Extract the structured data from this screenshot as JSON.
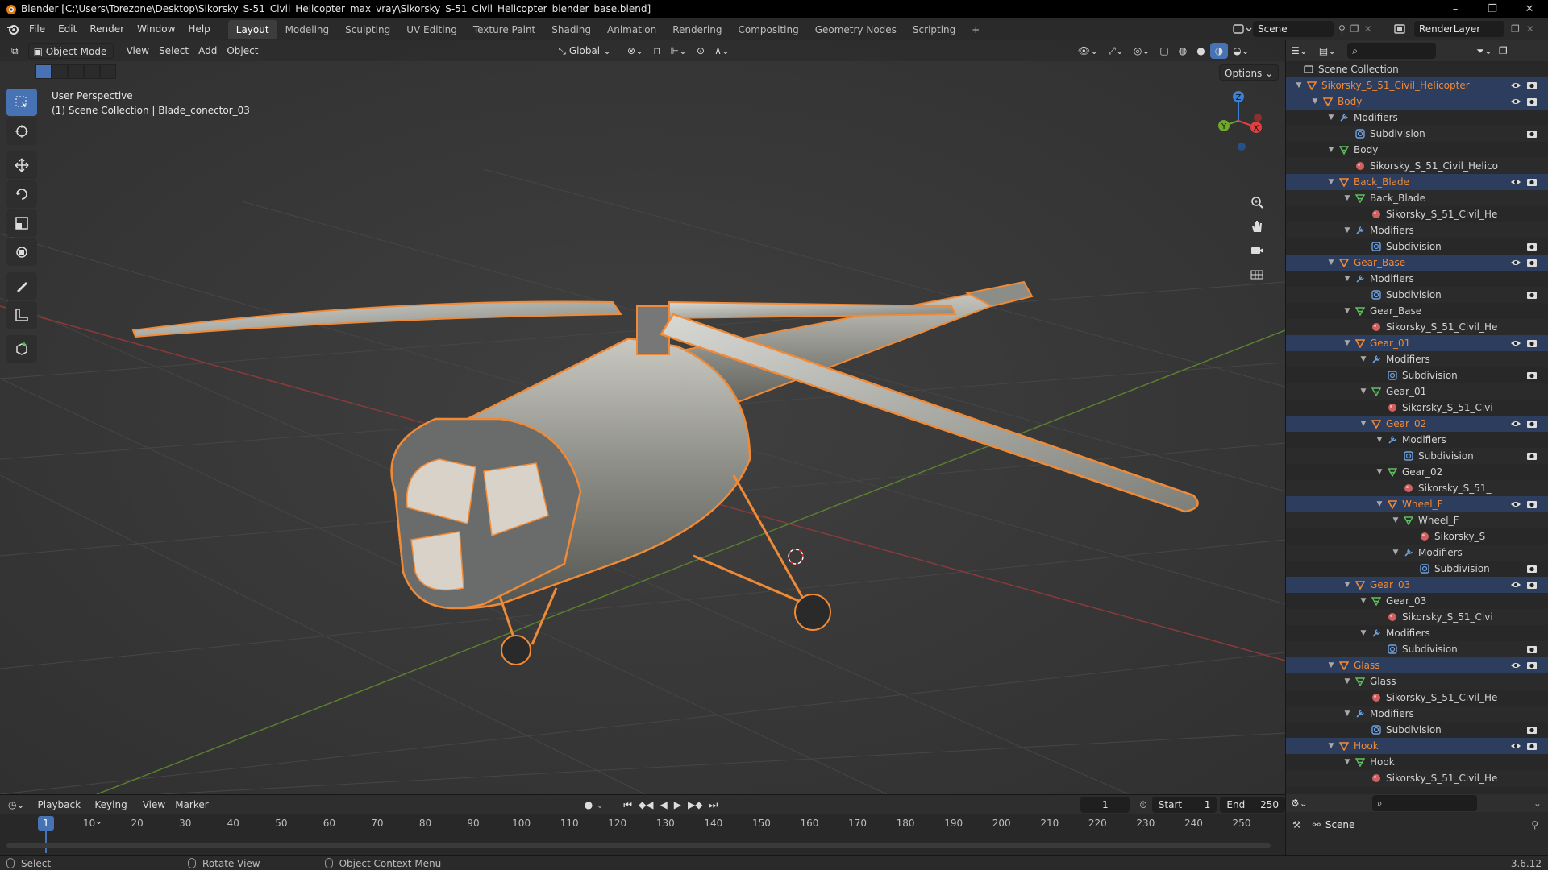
{
  "window": {
    "title": "Blender [C:\\Users\\Torezone\\Desktop\\Sikorsky_S-51_Civil_Helicopter_max_vray\\Sikorsky_S-51_Civil_Helicopter_blender_base.blend]",
    "minimize": "–",
    "maximize": "❐",
    "close": "✕"
  },
  "menu": {
    "items": [
      "File",
      "Edit",
      "Render",
      "Window",
      "Help"
    ],
    "workspaces": [
      "Layout",
      "Modeling",
      "Sculpting",
      "UV Editing",
      "Texture Paint",
      "Shading",
      "Animation",
      "Rendering",
      "Compositing",
      "Geometry Nodes",
      "Scripting"
    ],
    "active_workspace": "Layout",
    "add_tab": "+",
    "scene": "Scene",
    "render_layer": "RenderLayer"
  },
  "viewport": {
    "mode": "Object Mode",
    "menus": [
      "View",
      "Select",
      "Add",
      "Object"
    ],
    "transform_orientation": "Global",
    "options_label": "Options",
    "info_line1": "User Perspective",
    "info_line2": "(1) Scene Collection | Blade_conector_03",
    "gizmo_labels": {
      "z": "Z",
      "y": "Y",
      "x": "X"
    }
  },
  "outliner": {
    "root": "Scene Collection",
    "rows": [
      {
        "label": "Sikorsky_S_51_Civil_Helicopter",
        "depth": 0,
        "type": "object",
        "orange": true,
        "selected": true,
        "vis": true
      },
      {
        "label": "Body",
        "depth": 1,
        "type": "object",
        "orange": true,
        "selected": true,
        "vis": true
      },
      {
        "label": "Modifiers",
        "depth": 2,
        "type": "modifiers",
        "orange": false,
        "selected": false,
        "vis": false
      },
      {
        "label": "Subdivision",
        "depth": 3,
        "type": "subdiv",
        "orange": false,
        "selected": false,
        "vis": "cam"
      },
      {
        "label": "Body",
        "depth": 2,
        "type": "mesh",
        "orange": false,
        "selected": false,
        "vis": false
      },
      {
        "label": "Sikorsky_S_51_Civil_Helico",
        "depth": 3,
        "type": "material",
        "orange": false,
        "selected": false,
        "vis": false
      },
      {
        "label": "Back_Blade",
        "depth": 2,
        "type": "object",
        "orange": true,
        "selected": true,
        "vis": true
      },
      {
        "label": "Back_Blade",
        "depth": 3,
        "type": "mesh",
        "orange": false,
        "selected": false,
        "vis": false
      },
      {
        "label": "Sikorsky_S_51_Civil_He",
        "depth": 4,
        "type": "material",
        "orange": false,
        "selected": false,
        "vis": false
      },
      {
        "label": "Modifiers",
        "depth": 3,
        "type": "modifiers",
        "orange": false,
        "selected": false,
        "vis": false
      },
      {
        "label": "Subdivision",
        "depth": 4,
        "type": "subdiv",
        "orange": false,
        "selected": false,
        "vis": "cam"
      },
      {
        "label": "Gear_Base",
        "depth": 2,
        "type": "object",
        "orange": true,
        "selected": true,
        "vis": true
      },
      {
        "label": "Modifiers",
        "depth": 3,
        "type": "modifiers",
        "orange": false,
        "selected": false,
        "vis": false
      },
      {
        "label": "Subdivision",
        "depth": 4,
        "type": "subdiv",
        "orange": false,
        "selected": false,
        "vis": "cam"
      },
      {
        "label": "Gear_Base",
        "depth": 3,
        "type": "mesh",
        "orange": false,
        "selected": false,
        "vis": false
      },
      {
        "label": "Sikorsky_S_51_Civil_He",
        "depth": 4,
        "type": "material",
        "orange": false,
        "selected": false,
        "vis": false
      },
      {
        "label": "Gear_01",
        "depth": 3,
        "type": "object",
        "orange": true,
        "selected": true,
        "vis": true
      },
      {
        "label": "Modifiers",
        "depth": 4,
        "type": "modifiers",
        "orange": false,
        "selected": false,
        "vis": false
      },
      {
        "label": "Subdivision",
        "depth": 5,
        "type": "subdiv",
        "orange": false,
        "selected": false,
        "vis": "cam"
      },
      {
        "label": "Gear_01",
        "depth": 4,
        "type": "mesh",
        "orange": false,
        "selected": false,
        "vis": false
      },
      {
        "label": "Sikorsky_S_51_Civi",
        "depth": 5,
        "type": "material",
        "orange": false,
        "selected": false,
        "vis": false
      },
      {
        "label": "Gear_02",
        "depth": 4,
        "type": "object",
        "orange": true,
        "selected": true,
        "vis": true
      },
      {
        "label": "Modifiers",
        "depth": 5,
        "type": "modifiers",
        "orange": false,
        "selected": false,
        "vis": false
      },
      {
        "label": "Subdivision",
        "depth": 6,
        "type": "subdiv",
        "orange": false,
        "selected": false,
        "vis": "cam"
      },
      {
        "label": "Gear_02",
        "depth": 5,
        "type": "mesh",
        "orange": false,
        "selected": false,
        "vis": false
      },
      {
        "label": "Sikorsky_S_51_",
        "depth": 6,
        "type": "material",
        "orange": false,
        "selected": false,
        "vis": false
      },
      {
        "label": "Wheel_F",
        "depth": 5,
        "type": "object",
        "orange": true,
        "selected": true,
        "vis": true
      },
      {
        "label": "Wheel_F",
        "depth": 6,
        "type": "mesh",
        "orange": false,
        "selected": false,
        "vis": false
      },
      {
        "label": "Sikorsky_S",
        "depth": 7,
        "type": "material",
        "orange": false,
        "selected": false,
        "vis": false
      },
      {
        "label": "Modifiers",
        "depth": 6,
        "type": "modifiers",
        "orange": false,
        "selected": false,
        "vis": false
      },
      {
        "label": "Subdivision",
        "depth": 7,
        "type": "subdiv",
        "orange": false,
        "selected": false,
        "vis": "cam"
      },
      {
        "label": "Gear_03",
        "depth": 3,
        "type": "object",
        "orange": true,
        "selected": true,
        "vis": true
      },
      {
        "label": "Gear_03",
        "depth": 4,
        "type": "mesh",
        "orange": false,
        "selected": false,
        "vis": false
      },
      {
        "label": "Sikorsky_S_51_Civi",
        "depth": 5,
        "type": "material",
        "orange": false,
        "selected": false,
        "vis": false
      },
      {
        "label": "Modifiers",
        "depth": 4,
        "type": "modifiers",
        "orange": false,
        "selected": false,
        "vis": false
      },
      {
        "label": "Subdivision",
        "depth": 5,
        "type": "subdiv",
        "orange": false,
        "selected": false,
        "vis": "cam"
      },
      {
        "label": "Glass",
        "depth": 2,
        "type": "object",
        "orange": true,
        "selected": true,
        "vis": true
      },
      {
        "label": "Glass",
        "depth": 3,
        "type": "mesh",
        "orange": false,
        "selected": false,
        "vis": false
      },
      {
        "label": "Sikorsky_S_51_Civil_He",
        "depth": 4,
        "type": "material",
        "orange": false,
        "selected": false,
        "vis": false
      },
      {
        "label": "Modifiers",
        "depth": 3,
        "type": "modifiers",
        "orange": false,
        "selected": false,
        "vis": false
      },
      {
        "label": "Subdivision",
        "depth": 4,
        "type": "subdiv",
        "orange": false,
        "selected": false,
        "vis": "cam"
      },
      {
        "label": "Hook",
        "depth": 2,
        "type": "object",
        "orange": true,
        "selected": true,
        "vis": true
      },
      {
        "label": "Hook",
        "depth": 3,
        "type": "mesh",
        "orange": false,
        "selected": false,
        "vis": false
      },
      {
        "label": "Sikorsky_S_51_Civil_He",
        "depth": 4,
        "type": "material",
        "orange": false,
        "selected": false,
        "vis": false
      }
    ]
  },
  "properties": {
    "scene_label": "Scene"
  },
  "timeline": {
    "menus": [
      "Playback",
      "Keying",
      "View",
      "Marker"
    ],
    "current_frame": "1",
    "start_label": "Start",
    "start_value": "1",
    "end_label": "End",
    "end_value": "250",
    "ticks": [
      "1",
      "10",
      "20",
      "30",
      "40",
      "50",
      "60",
      "70",
      "80",
      "90",
      "100",
      "110",
      "120",
      "130",
      "140",
      "150",
      "160",
      "170",
      "180",
      "190",
      "200",
      "210",
      "220",
      "230",
      "240",
      "250"
    ]
  },
  "statusbar": {
    "select": "Select",
    "rotate": "Rotate View",
    "context": "Object Context Menu",
    "version": "3.6.12"
  },
  "colors": {
    "accent": "#4772b3",
    "selection_outline": "#f08a36",
    "axis_x": "#e0403f",
    "axis_y": "#6fa82a",
    "axis_z": "#3b80d8"
  }
}
